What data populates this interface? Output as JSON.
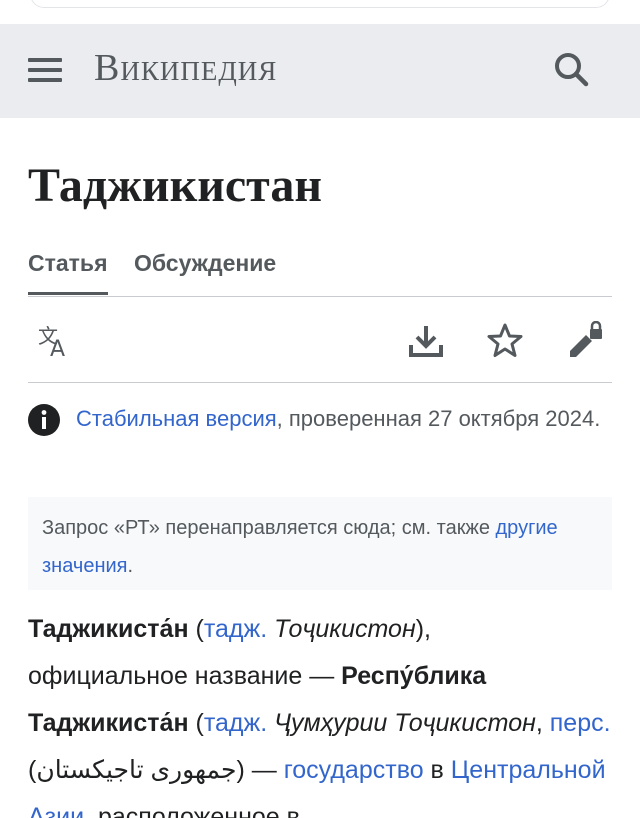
{
  "header": {
    "logo_text": "Википедия",
    "menu_icon": "hamburger-menu-icon",
    "search_icon": "search-icon"
  },
  "page": {
    "title": "Таджикистан"
  },
  "tabs": [
    {
      "label": "Статья",
      "active": true
    },
    {
      "label": "Обсуждение",
      "active": false
    }
  ],
  "actions": {
    "language_icon": "language-translate-icon",
    "download_icon": "download-icon",
    "watch_icon": "star-icon",
    "edit_icon": "edit-locked-icon"
  },
  "stable_notice": {
    "link": "Стабильная версия",
    "rest": ", проверенная 27 октября 2024."
  },
  "hatnote": {
    "text": "Запрос «РТ» перенаправляется сюда; см. также ",
    "link": "другие значения",
    "end": "."
  },
  "lead": {
    "name_bold": "Таджикиста́н",
    "open_paren": " (",
    "lang1_link": "тадж.",
    "native1": " Тоҷикистон",
    "close1": "),",
    "line2_pre": " официальное название — ",
    "official_bold": "Респу́блика Таджикиста́н",
    "open_paren2": " (",
    "lang2_link": "тадж.",
    "native2": " Ҷумҳурии Тоҷикистон",
    "comma": ", ",
    "lang3_link": "перс.",
    "persian": " (جمهوری تاجیکستان)",
    "dash": " — ",
    "state_link": "государство",
    "in": " в ",
    "region_link": "Центральной Азии",
    "tail": ", расположенное в"
  },
  "colors": {
    "header_bg": "#eaecf0",
    "link": "#3366cc",
    "text": "#202122",
    "muted": "#54595d"
  }
}
